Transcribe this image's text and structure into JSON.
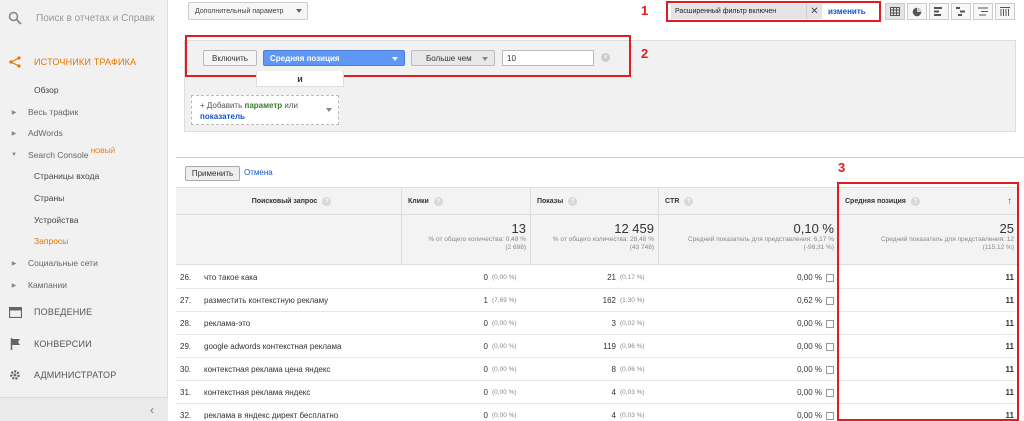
{
  "sidebar": {
    "search_placeholder": "Поиск в отчетах и Справк",
    "sections": [
      {
        "label": "ИСТОЧНИКИ ТРАФИКА",
        "icon": "traffic-sources-icon"
      },
      {
        "label": "ПОВЕДЕНИЕ",
        "icon": "behavior-icon"
      },
      {
        "label": "КОНВЕРСИИ",
        "icon": "flag-icon"
      },
      {
        "label": "АДМИНИСТРАТОР",
        "icon": "gear-icon"
      }
    ],
    "items": [
      {
        "label": "Обзор"
      },
      {
        "label": "Весь трафик"
      },
      {
        "label": "AdWords"
      },
      {
        "label": "Search Console",
        "badge": "НОВЫЙ"
      },
      {
        "label": "Страницы входа"
      },
      {
        "label": "Страны"
      },
      {
        "label": "Устройства"
      },
      {
        "label": "Запросы"
      },
      {
        "label": "Социальные сети"
      },
      {
        "label": "Кампании"
      }
    ],
    "collapse": "‹"
  },
  "toolbar": {
    "secondary_dimension": "Дополнительный параметр",
    "filter_status": "Расширенный фильтр включен",
    "filter_clear": "✕",
    "filter_edit": "изменить"
  },
  "annotations": {
    "n1": "1",
    "n2": "2",
    "n3": "3"
  },
  "filter": {
    "include_label": "Включить",
    "dimension": "Средняя позиция",
    "operator": "Больше чем",
    "value": "10",
    "and_label": "и",
    "add_prefix": "+ Добавить ",
    "add_param": "параметр",
    "add_or": " или",
    "add_metric": "показатель"
  },
  "apply": {
    "apply_label": "Применить",
    "cancel_label": "Отмена"
  },
  "table": {
    "headers": {
      "query": "Поисковый запрос",
      "clicks": "Клики",
      "impressions": "Показы",
      "ctr": "CTR",
      "position": "Средняя позиция",
      "sort": "↑"
    },
    "totals": {
      "clicks": "13",
      "clicks_sub1": "% от общего количества: 0,48 %",
      "clicks_sub2": "(2 698)",
      "impressions": "12 459",
      "impressions_sub1": "% от общего количества: 28,48 %",
      "impressions_sub2": "(43 748)",
      "ctr": "0,10 %",
      "ctr_sub1": "Средний показатель для представления: 6,17 %",
      "ctr_sub2": "(-98,31 %)",
      "position": "25",
      "position_sub1": "Средний показатель для представления: 12",
      "position_sub2": "(115,12 %)"
    },
    "rows": [
      {
        "n": "26.",
        "q": "что такое кака",
        "clicks": "0",
        "clicks_pct": "(0,00 %)",
        "imp": "21",
        "imp_pct": "(0,17 %)",
        "ctr": "0,00 %",
        "pos": "11"
      },
      {
        "n": "27.",
        "q": "разместить контекстную рекламу",
        "clicks": "1",
        "clicks_pct": "(7,69 %)",
        "imp": "162",
        "imp_pct": "(1,30 %)",
        "ctr": "0,62 %",
        "pos": "11"
      },
      {
        "n": "28.",
        "q": "реклама-это",
        "clicks": "0",
        "clicks_pct": "(0,00 %)",
        "imp": "3",
        "imp_pct": "(0,02 %)",
        "ctr": "0,00 %",
        "pos": "11"
      },
      {
        "n": "29.",
        "q": "google adwords контекстная реклама",
        "clicks": "0",
        "clicks_pct": "(0,00 %)",
        "imp": "119",
        "imp_pct": "(0,96 %)",
        "ctr": "0,00 %",
        "pos": "11"
      },
      {
        "n": "30.",
        "q": "контекстная реклама цена яндекс",
        "clicks": "0",
        "clicks_pct": "(0,00 %)",
        "imp": "8",
        "imp_pct": "(0,06 %)",
        "ctr": "0,00 %",
        "pos": "11"
      },
      {
        "n": "31.",
        "q": "контекстная реклама яндекс",
        "clicks": "0",
        "clicks_pct": "(0,00 %)",
        "imp": "4",
        "imp_pct": "(0,03 %)",
        "ctr": "0,00 %",
        "pos": "11"
      },
      {
        "n": "32.",
        "q": "реклама в яндекс директ бесплатно",
        "clicks": "0",
        "clicks_pct": "(0,00 %)",
        "imp": "4",
        "imp_pct": "(0,03 %)",
        "ctr": "0,00 %",
        "pos": "11"
      }
    ]
  },
  "colors": {
    "accent": "#e37400",
    "annotation": "#e11b22",
    "link": "#1155cc",
    "dimension_chip": "#5e97f6"
  }
}
